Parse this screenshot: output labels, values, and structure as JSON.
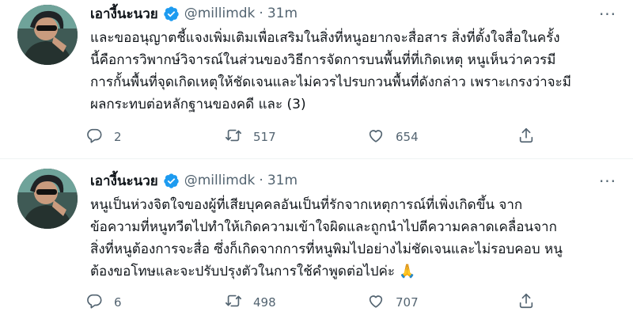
{
  "tweets": [
    {
      "author": {
        "name": "เอางี้นะนวย",
        "handle": "@millimdk",
        "time": "31m"
      },
      "separator": "·",
      "more_label": "···",
      "lines": [
        "และขออนุญาตชี้แจงเพิ่มเติมเพื่อเสริมในสิ่งที่หนูอยากจะสื่อสาร สิ่งที่ตั้งใจสื่อในครั้ง",
        "นี้คือการวิพากษ์วิจารณ์ในส่วนของวิธีการจัดการบนพื้นที่ที่เกิดเหตุ หนูเห็นว่าควรมี",
        "การกั้นพื้นที่จุดเกิดเหตุให้ชัดเจนและไม่ควรไปรบกวนพื้นที่ดังกล่าว เพราะเกรงว่าจะมี",
        "ผลกระทบต่อหลักฐานของคดี และ (3)"
      ],
      "stats": {
        "replies": "2",
        "retweets": "517",
        "likes": "654"
      }
    },
    {
      "author": {
        "name": "เอางี้นะนวย",
        "handle": "@millimdk",
        "time": "31m"
      },
      "separator": "·",
      "more_label": "···",
      "lines": [
        "หนูเป็นห่วงจิตใจของผู้ที่เสียบุคคลอันเป็นที่รักจากเหตุการณ์ที่เพิ่งเกิดขึ้น จาก",
        "ข้อความที่หนูทวีตไปทำให้เกิดความเข้าใจผิดและถูกนำไปตีความคลาดเคลื่อนจาก",
        "สิ่งที่หนูต้องการจะสื่อ ซึ่งก็เกิดจากการที่หนูพิมไปอย่างไม่ชัดเจนและไม่รอบคอบ หนู",
        "ต้องขอโทษและจะปรับปรุงตัวในการใช้คำพูดต่อไปค่ะ 🙏"
      ],
      "stats": {
        "replies": "6",
        "retweets": "498",
        "likes": "707"
      }
    }
  ],
  "icons": {
    "verified": "verified-badge-icon",
    "reply": "reply-icon",
    "retweet": "retweet-icon",
    "like": "like-icon",
    "share": "share-icon"
  },
  "colors": {
    "verified": "#1d9bf0",
    "text": "#0f1419",
    "muted": "#536471",
    "divider": "#eff3f4"
  }
}
